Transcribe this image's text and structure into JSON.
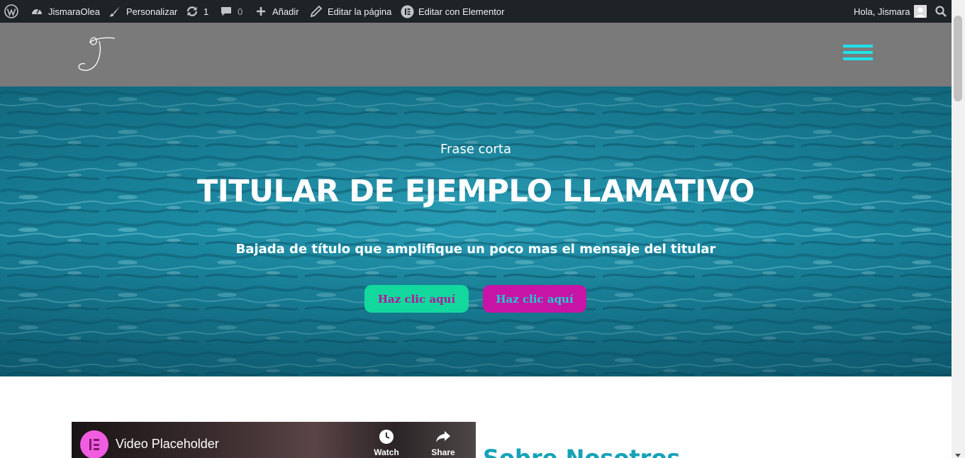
{
  "admin_bar": {
    "site_name": "JismaraOlea",
    "customize": "Personalizar",
    "updates_count": "1",
    "comments_count": "0",
    "add_new": "Añadir",
    "edit_page": "Editar la página",
    "edit_elementor": "Editar con Elementor",
    "greeting": "Hola, Jismara"
  },
  "hero": {
    "eyebrow": "Frase corta",
    "title": "TITULAR DE EJEMPLO LLAMATIVO",
    "subtitle": "Bajada de título que amplifique un poco mas el mensaje del titular",
    "button_primary": "Haz clic aquí",
    "button_secondary": "Haz clic aquí"
  },
  "video": {
    "title": "Video Placeholder",
    "watch_later": "Watch later",
    "share": "Share"
  },
  "about": {
    "title": "Sobre Nosotros"
  },
  "colors": {
    "admin_bar_bg": "#1d2327",
    "header_bg": "#7a7a7a",
    "hamburger": "#1ee3e9",
    "button_primary_bg": "#12d89e",
    "button_primary_text": "#b5159a",
    "button_secondary_bg": "#c814a6",
    "button_secondary_text": "#1ccfcf",
    "about_title": "#17a2b8"
  },
  "icons": {
    "wordpress": "wordpress-icon",
    "dashboard": "dashboard-icon",
    "customize": "brush-icon",
    "updates": "refresh-icon",
    "comments": "comment-icon",
    "add": "plus-icon",
    "edit": "pencil-icon",
    "elementor": "elementor-icon",
    "avatar": "avatar-icon",
    "search": "search-icon",
    "menu": "hamburger-menu-icon",
    "watch_later": "clock-icon",
    "share": "share-arrow-icon"
  }
}
